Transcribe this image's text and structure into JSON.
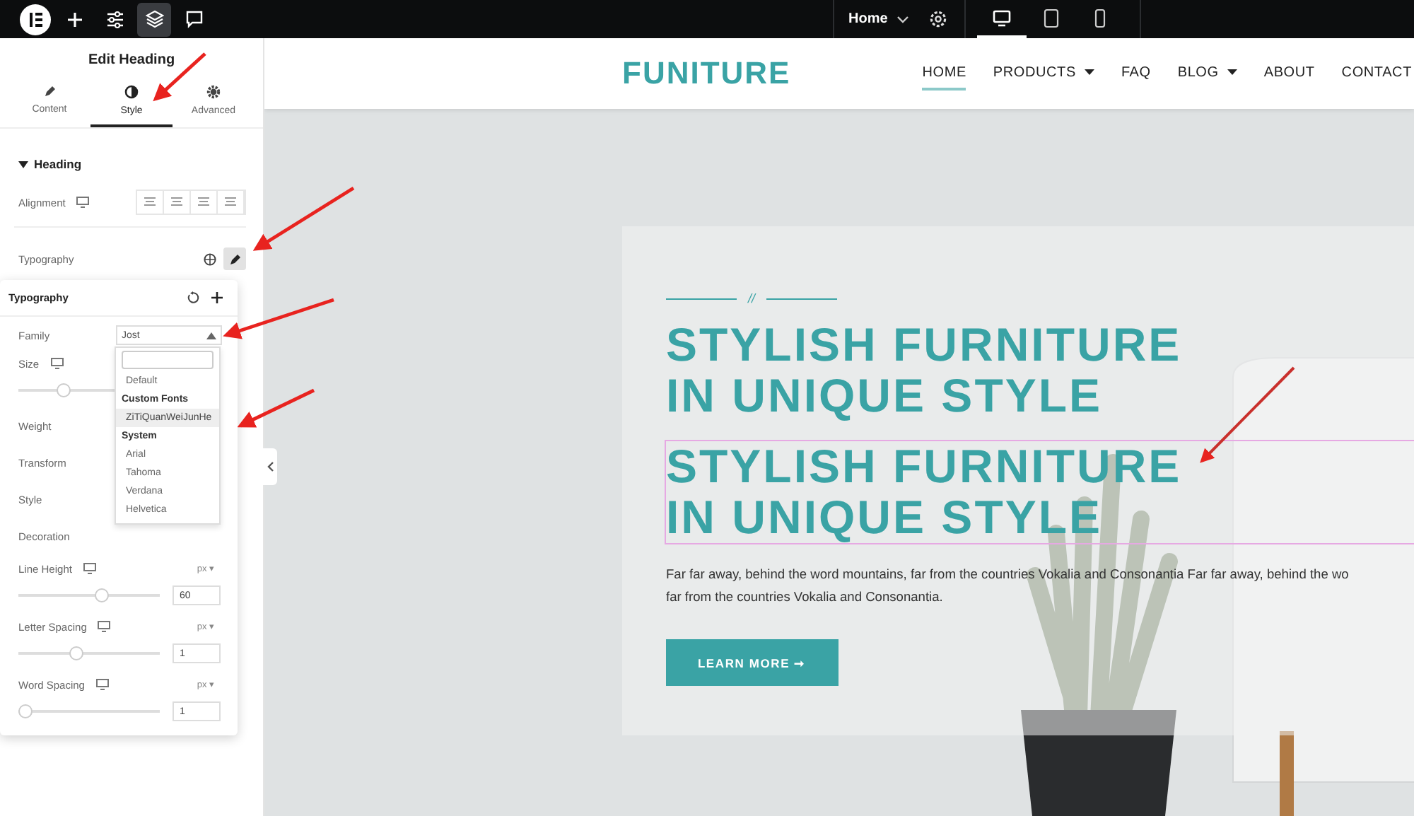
{
  "top_bar": {
    "tools": [
      {
        "kind": "logo",
        "selected": false
      },
      {
        "kind": "add",
        "selected": false
      },
      {
        "kind": "settings",
        "selected": false
      },
      {
        "kind": "layers",
        "selected": true
      },
      {
        "kind": "comments",
        "selected": false
      }
    ],
    "page_selector": "Home",
    "devices": [
      {
        "kind": "desktop",
        "selected": true
      },
      {
        "kind": "tablet",
        "selected": false
      },
      {
        "kind": "mobile",
        "selected": false
      }
    ]
  },
  "panel": {
    "title": "Edit Heading",
    "tabs": [
      {
        "kind": "content",
        "label": "Content",
        "selected": false
      },
      {
        "kind": "style",
        "label": "Style",
        "selected": true
      },
      {
        "kind": "advanced",
        "label": "Advanced",
        "selected": false
      }
    ],
    "section": {
      "title": "Heading",
      "expanded": true
    },
    "alignment": {
      "label": "Alignment"
    },
    "typography": {
      "label": "Typography",
      "editing": true
    },
    "popover": {
      "title": "Typography",
      "family": {
        "label": "Family",
        "value": "Jost",
        "open": true
      },
      "font_menu": [
        {
          "kind": "search"
        },
        {
          "kind": "option",
          "label": "Default",
          "selected": false
        },
        {
          "kind": "group",
          "label": "Custom Fonts"
        },
        {
          "kind": "option",
          "label": "ZiTiQuanWeiJunHe",
          "selected": true
        },
        {
          "kind": "group",
          "label": "System"
        },
        {
          "kind": "option",
          "label": "Arial",
          "selected": false
        },
        {
          "kind": "option",
          "label": "Tahoma",
          "selected": false
        },
        {
          "kind": "option",
          "label": "Verdana",
          "selected": false
        },
        {
          "kind": "option",
          "label": "Helvetica",
          "selected": false
        }
      ],
      "size": {
        "label": "Size",
        "level": 0.3
      },
      "rows": [
        "Weight",
        "Transform",
        "Style",
        "Decoration"
      ],
      "sliders": [
        {
          "label": "Line Height",
          "unit": "px ▾",
          "level": 0.6,
          "value": "60"
        },
        {
          "label": "Letter Spacing",
          "unit": "px ▾",
          "level": 0.4,
          "value": "1"
        },
        {
          "label": "Word Spacing",
          "unit": "px ▾",
          "level": 0,
          "value": "1"
        }
      ]
    }
  },
  "site": {
    "logo": "FUNITURE",
    "nav": [
      {
        "label": "HOME",
        "selected": true,
        "submenu": false
      },
      {
        "label": "PRODUCTS",
        "selected": false,
        "submenu": true
      },
      {
        "label": "FAQ",
        "selected": false,
        "submenu": false
      },
      {
        "label": "BLOG",
        "selected": false,
        "submenu": true
      },
      {
        "label": "ABOUT",
        "selected": false,
        "submenu": false
      },
      {
        "label": "CONTACT",
        "selected": false,
        "submenu": false
      }
    ],
    "hero": {
      "divider": "//",
      "headings": [
        {
          "lines": [
            "STYLISH FURNITURE",
            "IN UNIQUE STYLE"
          ],
          "selected": false
        },
        {
          "lines": [
            "STYLISH FURNITURE",
            "IN UNIQUE STYLE"
          ],
          "selected": true
        }
      ],
      "paragraph": [
        "Far far away, behind the word mountains, far from the countries Vokalia and Consonantia Far far away, behind the wo",
        "far from the countries Vokalia and Consonantia."
      ],
      "button": "LEARN MORE ➞"
    }
  }
}
